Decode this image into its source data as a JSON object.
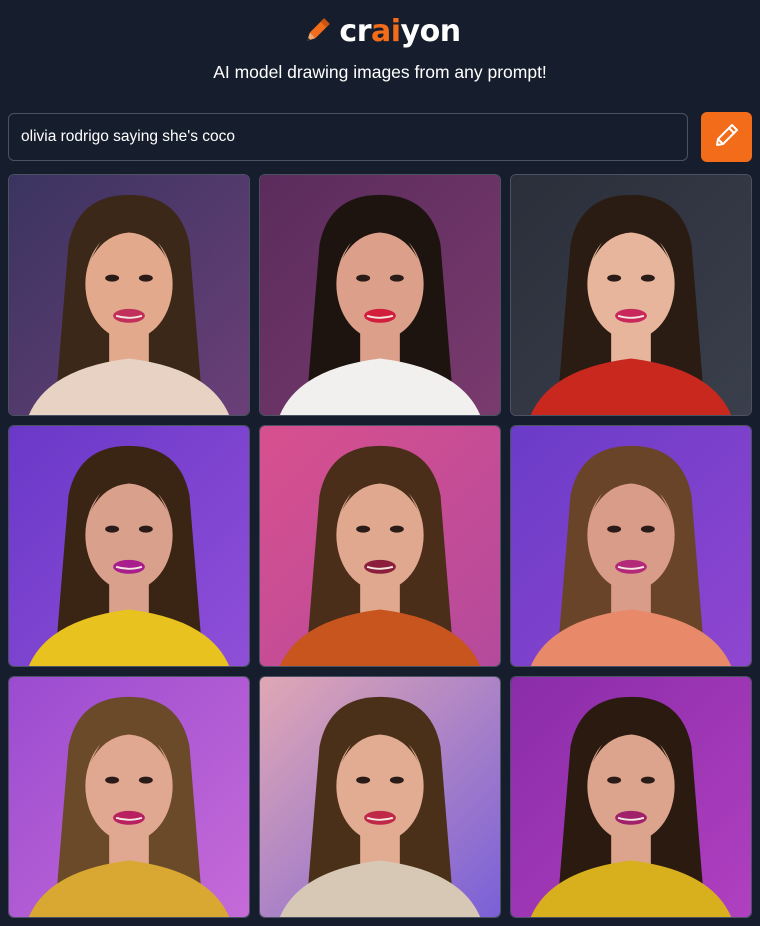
{
  "header": {
    "logo_icon": "pencil-icon",
    "logo_parts": [
      "cr",
      "ai",
      "yon"
    ],
    "brand_color": "#f36c1a",
    "tagline": "AI model drawing images from any prompt!"
  },
  "prompt": {
    "value": "olivia rodrigo saying she's coco",
    "button_icon": "pencil-icon"
  },
  "colors": {
    "background": "#161d2c",
    "accent": "#f36c1a",
    "border": "#4a5263"
  },
  "results": {
    "tiles": [
      {
        "bg1": "#3a3460",
        "bg2": "#6b3f78",
        "hair": "#3b2818",
        "skin": "#e2a98c",
        "cloth": "#e7d2c4",
        "lips": "#c0305a"
      },
      {
        "bg1": "#5a2c5c",
        "bg2": "#7a3a6e",
        "hair": "#1d1410",
        "skin": "#dca08a",
        "cloth": "#f2f0ee",
        "lips": "#d21e3c"
      },
      {
        "bg1": "#2b2f3a",
        "bg2": "#3a3f4c",
        "hair": "#2a1c12",
        "skin": "#e6b59c",
        "cloth": "#c9281e",
        "lips": "#c8285a"
      },
      {
        "bg1": "#6a38c8",
        "bg2": "#8f4fd8",
        "hair": "#3a2414",
        "skin": "#d9a08c",
        "cloth": "#e8c21e",
        "lips": "#a81e8c"
      },
      {
        "bg1": "#d8508e",
        "bg2": "#b44a9c",
        "hair": "#4a2e1a",
        "skin": "#e0a88e",
        "cloth": "#c8541e",
        "lips": "#8a1e3c"
      },
      {
        "bg1": "#6a3cc8",
        "bg2": "#8f46d0",
        "hair": "#6a4428",
        "skin": "#d89c88",
        "cloth": "#e88a6a",
        "lips": "#b4287a"
      },
      {
        "bg1": "#9a4cd0",
        "bg2": "#c66ad8",
        "hair": "#6a4a28",
        "skin": "#e0a890",
        "cloth": "#d8a832",
        "lips": "#b82060"
      },
      {
        "bg1": "#e0a8b4",
        "bg2": "#7a60d8",
        "hair": "#4a3018",
        "skin": "#e2ac92",
        "cloth": "#d6c8b4",
        "lips": "#c02848"
      },
      {
        "bg1": "#8a2ca8",
        "bg2": "#b040c0",
        "hair": "#2a1a10",
        "skin": "#dca48c",
        "cloth": "#d8b01e",
        "lips": "#a0206a"
      }
    ]
  }
}
